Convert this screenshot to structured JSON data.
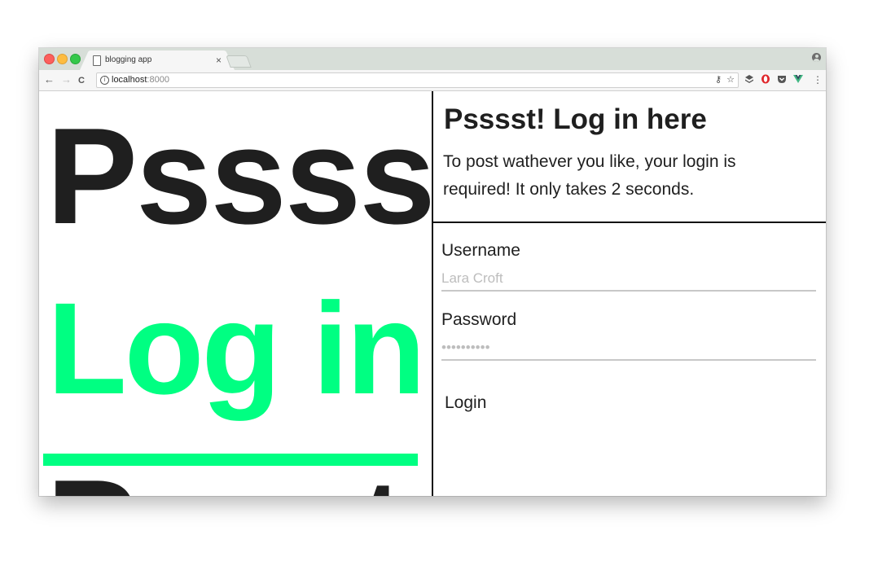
{
  "browser": {
    "tab_title": "blogging app",
    "tab_close": "×",
    "url_host": "localhost",
    "url_port": ":8000",
    "info_glyph": "i",
    "back_glyph": "←",
    "forward_glyph": "→",
    "reload_glyph": "C",
    "key_glyph": "⚷",
    "star_glyph": "☆",
    "menu_glyph": "⋮",
    "icons": [
      "page-icon",
      "profile-icon",
      "back-icon",
      "forward-icon",
      "reload-icon",
      "info-icon",
      "key-icon",
      "star-icon",
      "layers-extension-icon",
      "opera-extension-icon",
      "pocket-extension-icon",
      "vue-extension-icon",
      "menu-icon"
    ]
  },
  "hero": {
    "word": "Psssst",
    "link": "Log in",
    "third": "Pssst"
  },
  "login_panel": {
    "title": "Psssst! Log in here",
    "description": "To post wathever you like, your login is required! It only takes 2 seconds.",
    "username_label": "Username",
    "username_placeholder": "Lara Croft",
    "password_label": "Password",
    "password_placeholder": "••••••••••",
    "submit_label": "Login"
  },
  "colors": {
    "accent": "#00ff82",
    "text": "#1f1f1f",
    "tabstrip": "#d7ded8"
  }
}
